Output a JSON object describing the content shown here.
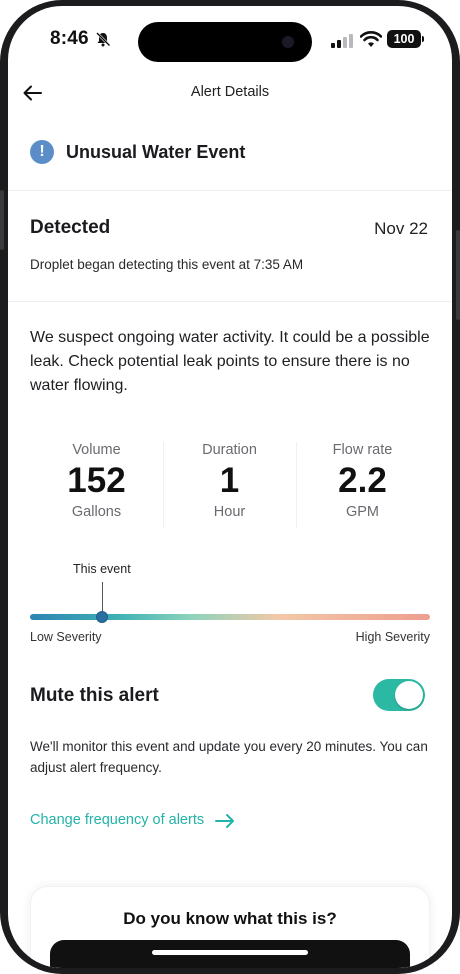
{
  "status_bar": {
    "time": "8:46",
    "battery": "100",
    "icons": [
      "bell-slash-icon",
      "signal-icon",
      "wifi-icon",
      "battery-icon"
    ]
  },
  "header": {
    "title": "Alert Details",
    "back_icon": "arrow-left-icon"
  },
  "alert": {
    "icon": "info-icon",
    "icon_glyph": "!",
    "title": "Unusual Water Event"
  },
  "detected": {
    "label": "Detected",
    "date": "Nov 22",
    "subtitle": "Droplet began detecting this event at 7:35 AM"
  },
  "description": "We suspect ongoing water activity. It could be a possible leak. Check potential leak points to ensure there is no water flowing.",
  "stats": [
    {
      "label": "Volume",
      "value": "152",
      "unit": "Gallons"
    },
    {
      "label": "Duration",
      "value": "1",
      "unit": "Hour"
    },
    {
      "label": "Flow rate",
      "value": "2.2",
      "unit": "GPM"
    }
  ],
  "severity": {
    "marker_label": "This event",
    "low_label": "Low Severity",
    "high_label": "High Severity",
    "level": 0.18
  },
  "mute": {
    "label": "Mute this alert",
    "enabled": true,
    "description": "We'll monitor this event and update you every 20 minutes. You can adjust alert frequency."
  },
  "link": {
    "label": "Change frequency of alerts",
    "icon": "arrow-right-icon"
  },
  "card": {
    "title": "Do you know what this is?"
  },
  "colors": {
    "accent": "#2bb9a4",
    "info": "#5b8ec9",
    "link": "#23b3a8"
  }
}
